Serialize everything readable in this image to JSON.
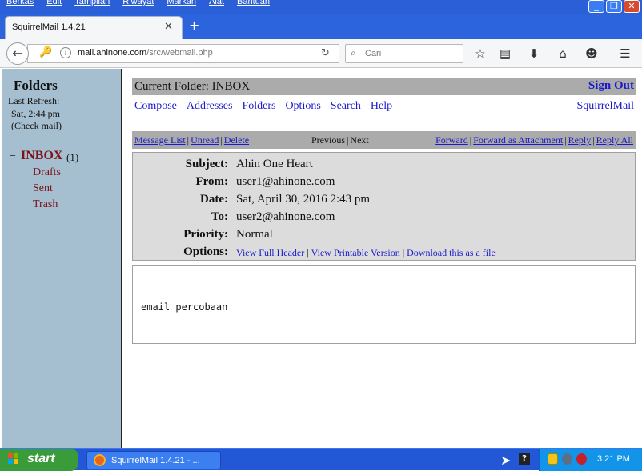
{
  "browser": {
    "menu": [
      "Berkas",
      "Edit",
      "Tampilan",
      "Riwayat",
      "Markah",
      "Alat",
      "Bantuan"
    ],
    "tab_title": "SquirrelMail 1.4.21",
    "url_host": "mail.ahinone.com",
    "url_path": "/src/webmail.php",
    "search_placeholder": "Cari"
  },
  "sidebar": {
    "title": "Folders",
    "last_refresh_label": "Last Refresh:",
    "last_refresh_time": "Sat, 2:44 pm",
    "check_mail": "Check mail",
    "collapse_symbol": "−",
    "inbox": "INBOX",
    "inbox_count": "(1)",
    "folders": [
      "Drafts",
      "Sent",
      "Trash"
    ]
  },
  "header": {
    "current_folder_label": "Current Folder:",
    "current_folder": "INBOX",
    "sign_out": "Sign Out",
    "nav": [
      "Compose",
      "Addresses",
      "Folders",
      "Options",
      "Search",
      "Help"
    ],
    "brand": "SquirrelMail"
  },
  "message_bar": {
    "message_list": "Message List",
    "unread": "Unread",
    "delete": "Delete",
    "previous": "Previous",
    "next": "Next",
    "forward": "Forward",
    "forward_attachment": "Forward as Attachment",
    "reply": "Reply",
    "reply_all": "Reply All"
  },
  "message": {
    "subject_label": "Subject:",
    "subject": "Ahin One Heart",
    "from_label": "From:",
    "from": "user1@ahinone.com",
    "date_label": "Date:",
    "date": "Sat, April 30, 2016 2:43 pm",
    "to_label": "To:",
    "to": "user2@ahinone.com",
    "priority_label": "Priority:",
    "priority": "Normal",
    "options_label": "Options:",
    "view_full_header": "View Full Header",
    "view_printable": "View Printable Version",
    "download": "Download this as a file",
    "body": "email percobaan"
  },
  "taskbar": {
    "start": "start",
    "task_label": "SquirrelMail 1.4.21 - ...",
    "clock": "3:21 PM"
  },
  "colors": {
    "sidebar_bg": "#a6bfd0",
    "bar_bg": "#ababab",
    "link": "#1a1acc",
    "folder": "#7a1418",
    "taskbar": "#2457d6"
  }
}
